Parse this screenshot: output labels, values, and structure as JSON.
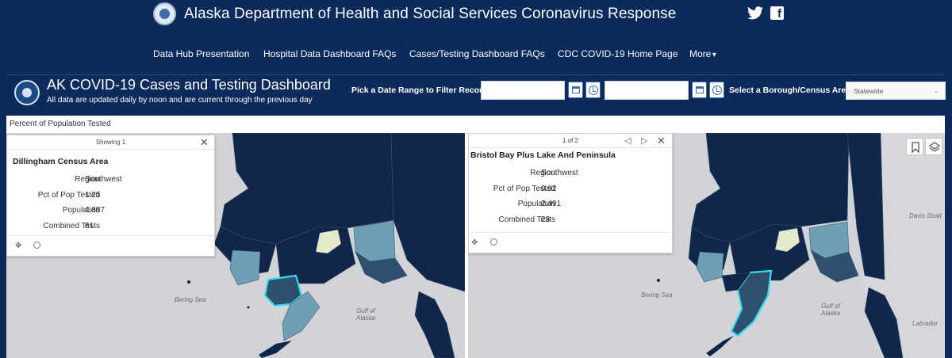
{
  "header": {
    "title": "Alaska Department of Health and Social Services Coronavirus Response",
    "social": [
      "twitter-icon",
      "facebook-icon"
    ]
  },
  "nav": {
    "items": [
      {
        "label": "Data Hub Presentation"
      },
      {
        "label": "Hospital Data Dashboard FAQs"
      },
      {
        "label": "Cases/Testing Dashboard FAQs"
      },
      {
        "label": "CDC COVID-19 Home Page"
      },
      {
        "label": "More"
      }
    ]
  },
  "dashboard": {
    "title": "AK COVID-19 Cases and Testing Dashboard",
    "subtitle": "All data are updated daily by noon and are current through the previous day",
    "date_label": "Pick a Date Range to Filter Records",
    "date_separator": "-",
    "borough_label": "Select a Borough/Census Area:",
    "borough_value": "Statewide"
  },
  "panel": {
    "title": "Percent of Population Tested"
  },
  "map_labels": {
    "bering_sea": "Bering Sea",
    "gulf_of_alaska": "Gulf of Alaska",
    "davis_strait": "Davis Strait",
    "labrador": "Labrador"
  },
  "popup_left": {
    "count": "Showing 1",
    "name": "Dillingham Census Area",
    "rows": [
      {
        "label": "Region",
        "value": "Southwest"
      },
      {
        "label": "Pct of Pop Tested",
        "value": "1.25"
      },
      {
        "label": "Population",
        "value": "4,887"
      },
      {
        "label": "Combined Tests",
        "value": "61"
      }
    ]
  },
  "popup_right": {
    "count": "1 of 2",
    "name": "Bristol Bay Plus Lake And Peninsula",
    "rows": [
      {
        "label": "Region",
        "value": "Southwest"
      },
      {
        "label": "Pct of Pop Tested",
        "value": "0.92"
      },
      {
        "label": "Population",
        "value": "2,491"
      },
      {
        "label": "Combined Tests",
        "value": "23"
      }
    ]
  },
  "colors": {
    "navy": "#0c2a5a",
    "map_dark": "#10264a",
    "map_mid": "#2e4f6d",
    "map_teal": "#6f9fb2",
    "map_light": "#e4ebca",
    "highlight": "#33ddee",
    "land_gray": "#d2d3d6"
  }
}
